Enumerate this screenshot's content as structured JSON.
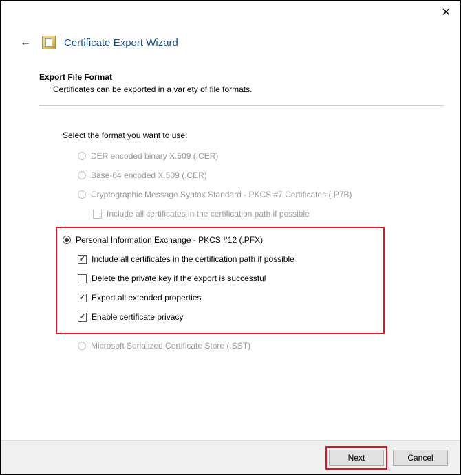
{
  "window": {
    "title": "Certificate Export Wizard"
  },
  "section": {
    "title": "Export File Format",
    "description": "Certificates can be exported in a variety of file formats."
  },
  "form": {
    "prompt": "Select the format you want to use:",
    "options": {
      "der": "DER encoded binary X.509 (.CER)",
      "base64": "Base-64 encoded X.509 (.CER)",
      "pkcs7": "Cryptographic Message Syntax Standard - PKCS #7 Certificates (.P7B)",
      "pkcs7_include": "Include all certificates in the certification path if possible",
      "pfx": "Personal Information Exchange - PKCS #12 (.PFX)",
      "pfx_include": "Include all certificates in the certification path if possible",
      "pfx_delete": "Delete the private key if the export is successful",
      "pfx_extended": "Export all extended properties",
      "pfx_privacy": "Enable certificate privacy",
      "sst": "Microsoft Serialized Certificate Store (.SST)"
    }
  },
  "buttons": {
    "next": "Next",
    "cancel": "Cancel"
  }
}
